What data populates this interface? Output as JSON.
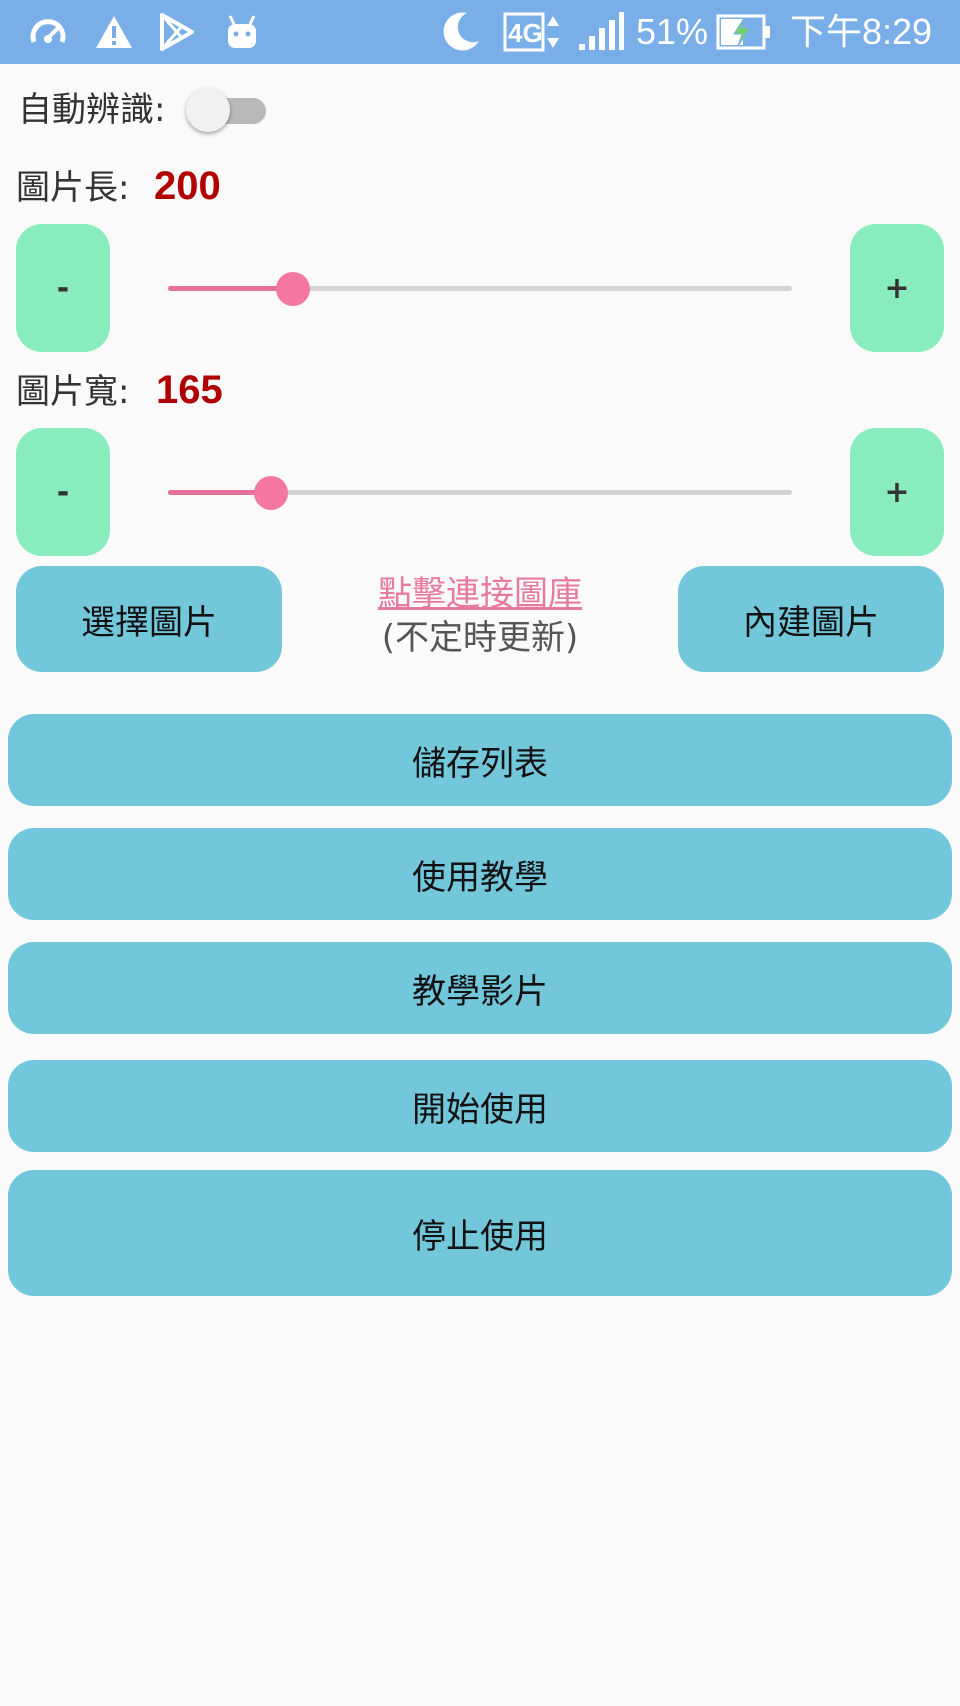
{
  "status_bar": {
    "icons_left": [
      "speedometer-icon",
      "warning-icon",
      "play-store-icon",
      "android-icon"
    ],
    "icons_right": [
      "moon-icon",
      "network-4g-icon",
      "signal-icon",
      "battery-charging-icon"
    ],
    "network": "4G",
    "battery_percent": "51%",
    "time": "下午8:29"
  },
  "auto_detect": {
    "label": "自動辨識:",
    "enabled": false
  },
  "image_length": {
    "label": "圖片長:",
    "value": "200",
    "minus_label": "-",
    "plus_label": "+",
    "slider_fraction": 0.2
  },
  "image_width": {
    "label": "圖片寬:",
    "value": "165",
    "minus_label": "-",
    "plus_label": "+",
    "slider_fraction": 0.165
  },
  "choose_image_label": "選擇圖片",
  "gallery_link": {
    "text": "點擊連接圖庫",
    "note": "(不定時更新)"
  },
  "builtin_image_label": "內建圖片",
  "actions": [
    "儲存列表",
    "使用教學",
    "教學影片",
    "開始使用",
    "停止使用"
  ],
  "colors": {
    "status_bar": "#7aaee8",
    "stepper_button": "#88ecbd",
    "primary_button": "#72c7db",
    "slider_active": "#f4779f",
    "value_text": "#b00000",
    "link_text": "#e87aa0"
  }
}
